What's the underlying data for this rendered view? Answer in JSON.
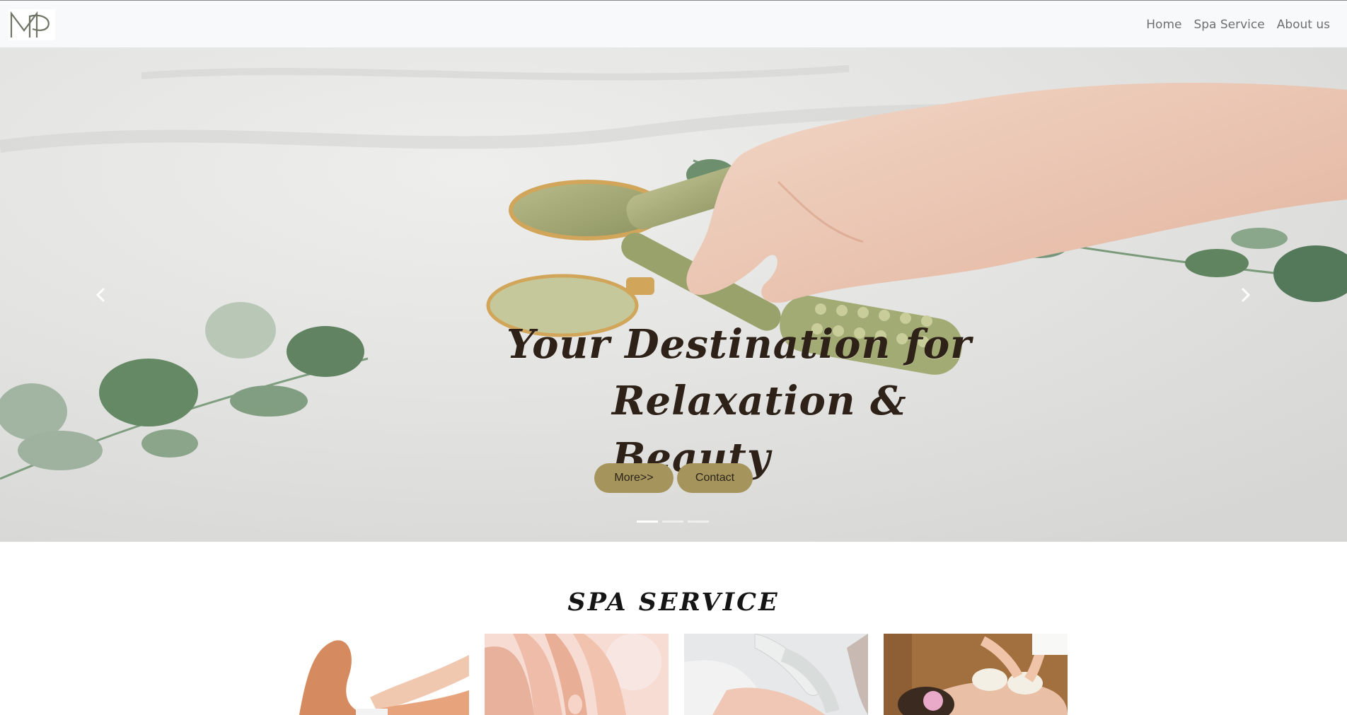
{
  "navbar": {
    "logo_icon": "mp-monogram-logo",
    "links": [
      "Home",
      "Spa Service",
      "About us"
    ]
  },
  "hero": {
    "title_line1": "Your Destination for",
    "title_line2": "Relaxation & Beauty",
    "more_button": "More>>",
    "contact_button": "Contact",
    "prev_icon": "chevron-left-icon",
    "next_icon": "chevron-right-icon",
    "slides_count": 3,
    "active_slide": 1
  },
  "services": {
    "title": "SPA SERVICE",
    "cards": [
      "leg-waxing-image",
      "manicure-image",
      "facial-treatment-image",
      "herbal-compress-massage-image"
    ]
  },
  "colors": {
    "navbar_bg": "#f8f9fa",
    "accent_button": "#a5955d",
    "title_text": "#2e2218"
  }
}
